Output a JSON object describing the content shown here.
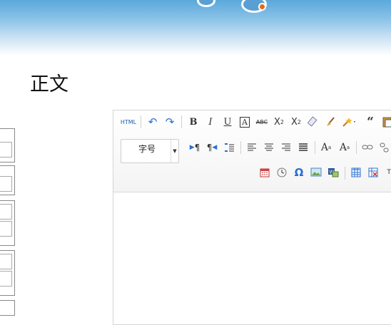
{
  "section": {
    "title": "正文"
  },
  "editor": {
    "html_label": "HTML",
    "font_size_label": "字号",
    "icons_row1": [
      "undo-icon",
      "redo-icon",
      "bold-icon",
      "italic-icon",
      "underline-icon",
      "font-border-icon",
      "strikethrough-icon",
      "superscript-icon",
      "subscript-icon",
      "eraser-icon",
      "format-brush-icon",
      "auto-format-icon",
      "blockquote-icon",
      "paste-plain-icon"
    ],
    "icons_row2": [
      "ltr-direction-icon",
      "rtl-direction-icon",
      "line-height-icon",
      "align-left-icon",
      "align-center-icon",
      "align-right-icon",
      "justify-icon",
      "font-color-icon",
      "background-color-icon",
      "link-icon",
      "unlink-icon"
    ],
    "icons_row3": [
      "insert-date-icon",
      "insert-time-icon",
      "special-char-icon",
      "insert-image-icon",
      "word-image-icon",
      "insert-table-icon",
      "delete-table-icon",
      "text-format-icon"
    ]
  }
}
